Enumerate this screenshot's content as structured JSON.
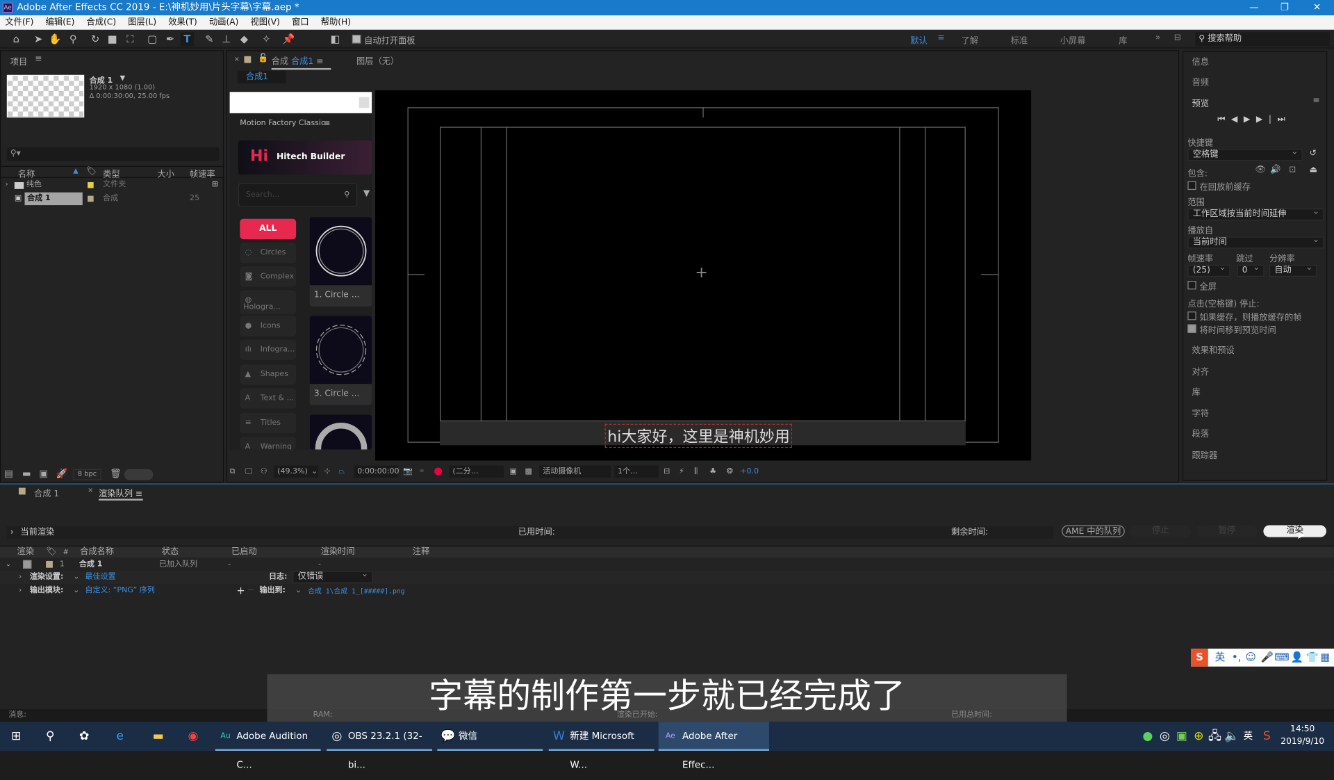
{
  "window": {
    "title": "Adobe After Effects CC 2019 - E:\\神机妙用\\片头字幕\\字幕.aep *",
    "logo": "Ae"
  },
  "menu": [
    "文件(F)",
    "编辑(E)",
    "合成(C)",
    "图层(L)",
    "效果(T)",
    "动画(A)",
    "视图(V)",
    "窗口",
    "帮助(H)"
  ],
  "toolbar": {
    "auto_open": "自动打开面板",
    "workspaces": [
      "默认",
      "了解",
      "标准",
      "小屏幕",
      "库"
    ],
    "active_workspace": "默认",
    "search_placeholder": "搜索帮助"
  },
  "project": {
    "title": "项目",
    "comp_name": "合成 1",
    "comp_size": "1920 x 1080 (1.00)",
    "comp_duration": "Δ 0:00:30:00, 25.00 fps",
    "columns": [
      "名称",
      "类型",
      "大小",
      "帧速率"
    ],
    "items": [
      {
        "name": "纯色",
        "type": "文件夹",
        "fps": "",
        "color": "#e6d04a"
      },
      {
        "name": "合成 1",
        "type": "合成",
        "fps": "25",
        "color": "#b9a88a"
      }
    ],
    "bpc": "8 bpc"
  },
  "comp": {
    "tab_prefix": "合成",
    "tab_name": "合成1",
    "layer_tab": "图层（无）",
    "subtab": "合成1",
    "zoom": "(49.3%)",
    "timecode": "0:00:00:00",
    "resolution": "(二分…",
    "camera": "活动摄像机",
    "views": "1个…",
    "exposure": "+0.0",
    "text_layer": "hi大家好，这里是神机妙用"
  },
  "extension": {
    "title": "Motion Factory Classic",
    "product": "Hitech Builder",
    "search_placeholder": "Search...",
    "categories": [
      "ALL",
      "Circles",
      "Complex",
      "Hologra...",
      "Icons",
      "Infogra...",
      "Shapes",
      "Text & ...",
      "Titles",
      "Warning"
    ],
    "thumbs": [
      "1. Circle ...",
      "3. Circle ..."
    ],
    "accent": "#e8294f"
  },
  "right": {
    "info": "信息",
    "audio": "音频",
    "preview": "预览",
    "shortcut_label": "快捷键",
    "shortcut": "空格键",
    "include": "包含:",
    "cache_before": "在回放前缓存",
    "range_label": "范围",
    "range": "工作区域按当前时间延伸",
    "play_from_label": "播放自",
    "play_from": "当前时间",
    "fps_label": "帧速率",
    "skip_label": "跳过",
    "res_label": "分辨率",
    "fps": "(25)",
    "skip": "0",
    "res": "自动",
    "fullscreen": "全屏",
    "stop_label": "点击(空格键) 停止:",
    "if_cached": "如果缓存，则播放缓存的帧",
    "move_time": "将时间移到预览时间",
    "panels": [
      "效果和预设",
      "对齐",
      "库",
      "字符",
      "段落",
      "跟踪器"
    ]
  },
  "render": {
    "tab_comp": "合成 1",
    "tab_queue": "渲染队列",
    "current": "当前渲染",
    "elapsed": "已用时间:",
    "remaining": "剩余时间:",
    "ame": "AME 中的队列",
    "stop": "停止",
    "pause": "暂停",
    "render": "渲染",
    "columns": [
      "渲染",
      "#",
      "合成名称",
      "状态",
      "已启动",
      "渲染时间",
      "注释"
    ],
    "item": {
      "num": "1",
      "name": "合成 1",
      "status": "已加入队列",
      "started": "-",
      "time": "-"
    },
    "settings_label": "渲染设置:",
    "settings": "最佳设置",
    "log_label": "日志:",
    "log": "仅错误",
    "output_label": "输出模块:",
    "output": "自定义: “PNG” 序列",
    "output_to_label": "输出到:",
    "output_to": "合成 1\\合成 1_[#####].png"
  },
  "status": {
    "msg": "消息:",
    "ram": "RAM:",
    "started": "渲染已开始:",
    "total": "已用总时间:"
  },
  "video_subtitle": "字幕的制作第一步就已经完成了",
  "taskbar": {
    "apps": [
      "Adobe Audition C...",
      "OBS 23.2.1 (32-bi...",
      "微信",
      "新建 Microsoft W...",
      "Adobe After Effec..."
    ],
    "time": "14:50",
    "date": "2019/9/10",
    "ime": "英"
  }
}
